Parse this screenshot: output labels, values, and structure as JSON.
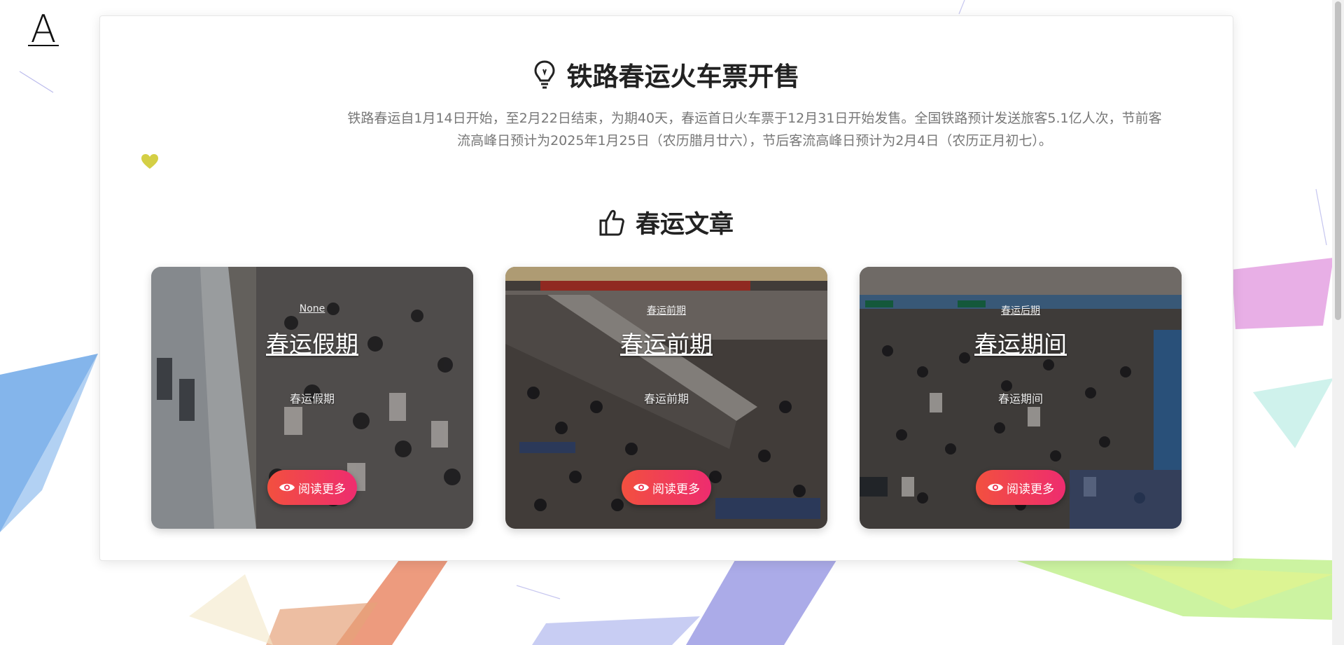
{
  "header": {
    "logo_text": "A"
  },
  "intro_section": {
    "title": "铁路春运火车票开售",
    "icon": "lightbulb-icon",
    "lines": [
      "铁路春运自1月14日开始，至2月22日结束，为期40天，春运首日火车票于12月31日开始发售。全国铁路预计发送旅客5.1亿人次，节前客",
      "流高峰日预计为2025年1月25日（农历腊月廿六），节后客流高峰日预计为2月4日（农历正月初七）。"
    ]
  },
  "decor": {
    "heart_icon": "heart-icon",
    "heart_color": "#d4cf45"
  },
  "articles_section": {
    "title": "春运文章",
    "icon": "thumbs-up-icon",
    "cards": [
      {
        "category": "None",
        "title": "春运假期",
        "description": "春运假期",
        "button_label": "阅读更多",
        "button_icon": "eye-icon"
      },
      {
        "category": "春运前期",
        "title": "春运前期",
        "description": "春运前期",
        "button_label": "阅读更多",
        "button_icon": "eye-icon"
      },
      {
        "category": "春运后期",
        "title": "春运期间",
        "description": "春运期间",
        "button_label": "阅读更多",
        "button_icon": "eye-icon"
      }
    ]
  },
  "colors": {
    "button_gradient_start": "#f2503f",
    "button_gradient_end": "#ee2c6f",
    "title_text": "#222222",
    "body_text": "#777777"
  }
}
